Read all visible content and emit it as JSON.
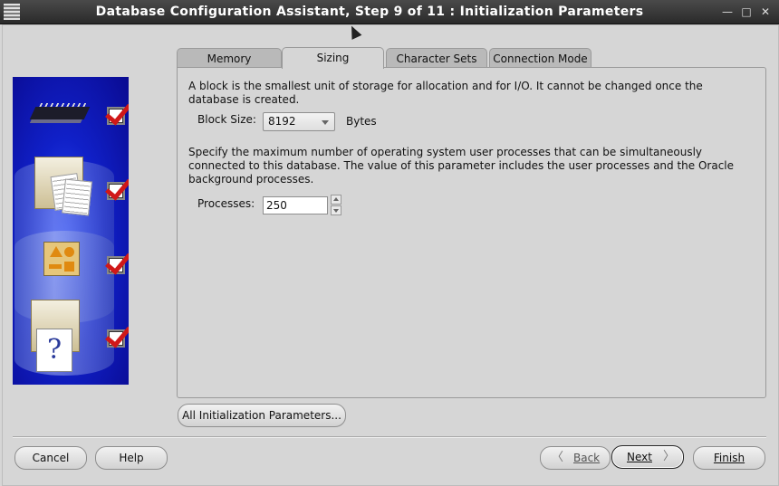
{
  "window": {
    "title": "Database Configuration Assistant, Step 9 of 11 : Initialization Parameters"
  },
  "tabs": [
    {
      "label": "Memory"
    },
    {
      "label": "Sizing"
    },
    {
      "label": "Character Sets"
    },
    {
      "label": "Connection Mode"
    }
  ],
  "sizing": {
    "block_desc": "A block is the smallest unit of storage for allocation and for I/O. It cannot be changed once the database is created.",
    "block_size_label": "Block Size:",
    "block_size_value": "8192",
    "block_size_unit": "Bytes",
    "process_desc": "Specify the maximum number of operating system user processes that can be simultaneously connected to this database. The value of this parameter includes the user processes and the Oracle background processes.",
    "processes_label": "Processes:",
    "processes_value": "250"
  },
  "buttons": {
    "all_params": "All Initialization Parameters...",
    "cancel": "Cancel",
    "help": "Help",
    "back": "Back",
    "next": "Next",
    "finish": "Finish"
  },
  "side_steps": [
    {
      "icon": "memory-chip-icon",
      "checked": true
    },
    {
      "icon": "database-documents-icon",
      "checked": true
    },
    {
      "icon": "shapes-folder-icon",
      "checked": true
    },
    {
      "icon": "help-document-icon",
      "checked": true
    }
  ],
  "colors": {
    "titlebar": "#2f2f2f",
    "side_panel": "#1525d0",
    "checkmark": "#d01818",
    "dialog_bg": "#d6d6d6"
  }
}
